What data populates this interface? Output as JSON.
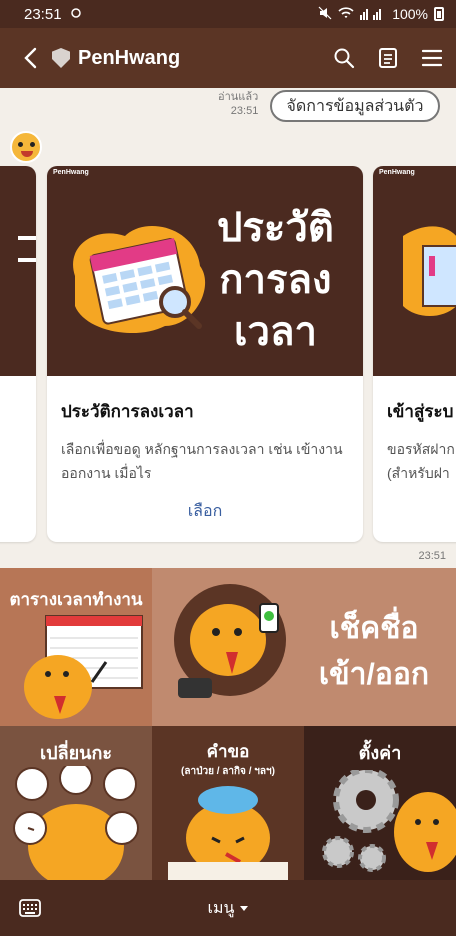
{
  "status_bar": {
    "time": "23:51",
    "battery": "100%"
  },
  "header": {
    "title": "PenHwang"
  },
  "chat": {
    "read_label": "อ่านแล้ว",
    "read_time": "23:51",
    "manage_button": "จัดการข้อมูลส่วนตัว",
    "message_time": "23:51",
    "cards": [
      {
        "brand": "PenHwang",
        "banner": [
          "ประวัติ",
          "การลง",
          "เวลา"
        ],
        "title": "ประวัติการลงเวลา",
        "desc": "เลือกเพื่อขอดู หลักฐานการลงเวลา เช่น เข้างาน ออกงาน เมื่อไร",
        "action": "เลือก"
      },
      {
        "brand": "PenHwang",
        "title": "เข้าสู่ระบ",
        "desc": "ขอรหัสฝาก (สำหรับฝา"
      }
    ]
  },
  "menu": {
    "tiles": [
      {
        "label": "ตารางเวลาทำงาน"
      },
      {
        "label": "เช็คชื่อ",
        "sub": "เข้า/ออก"
      },
      {
        "label": "เปลี่ยนกะ"
      },
      {
        "label": "คำขอ",
        "sub": "(ลาป่วย / ลากิจ / ฯลฯ)"
      },
      {
        "label": "ตั้งค่า"
      }
    ],
    "toggle_label": "เมนู"
  },
  "icons": {
    "back": "back-arrow-icon",
    "search": "search-icon",
    "notes": "notes-icon",
    "menu": "hamburger-icon",
    "keyboard": "keyboard-icon"
  }
}
